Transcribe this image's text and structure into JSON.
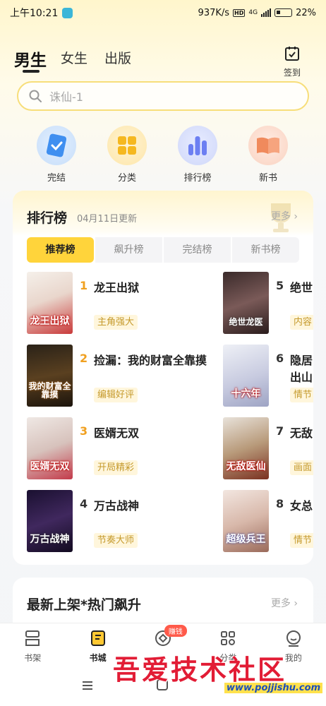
{
  "status_bar": {
    "time": "上午10:21",
    "net_speed": "937K/s",
    "hd": "HD",
    "network": "4G",
    "battery": "22%"
  },
  "top_nav": {
    "tabs": [
      {
        "label": "男生"
      },
      {
        "label": "女生"
      },
      {
        "label": "出版"
      }
    ],
    "active_tab": "男生",
    "checkin_label": "签到"
  },
  "search": {
    "placeholder": "诛仙-1"
  },
  "quick_entries": [
    {
      "label": "完结",
      "icon": "notebook-icon",
      "color": "#3f8ff0"
    },
    {
      "label": "分类",
      "icon": "category-grid-icon",
      "color": "#f5b820"
    },
    {
      "label": "排行榜",
      "icon": "bar-rank-icon",
      "color": "#6c7ff2"
    },
    {
      "label": "新书",
      "icon": "open-book-icon",
      "color": "#f08a5c"
    }
  ],
  "ranking": {
    "title": "排行榜",
    "updated": "04月11日更新",
    "more": "更多",
    "tabs": [
      {
        "label": "推荐榜"
      },
      {
        "label": "飙升榜"
      },
      {
        "label": "完结榜"
      },
      {
        "label": "新书榜"
      }
    ],
    "active_tab": "推荐榜",
    "books": [
      {
        "rank": "1",
        "title": "龙王出狱",
        "tag": "主角强大",
        "cover_text": "龙王出狱"
      },
      {
        "rank": "2",
        "title": "捡漏：我的财富全靠摸",
        "tag": "编辑好评",
        "cover_text": "我的财富全靠摸"
      },
      {
        "rank": "3",
        "title": "医婿无双",
        "tag": "开局精彩",
        "cover_text": "医婿无双"
      },
      {
        "rank": "4",
        "title": "万古战神",
        "tag": "节奏大师",
        "cover_text": "万古战神"
      },
      {
        "rank": "5",
        "title": "绝世",
        "tag": "内容",
        "cover_text": "绝世龙医"
      },
      {
        "rank": "6",
        "title": "隐居",
        "title_line2": "出山",
        "tag": "情节",
        "cover_text": "十六年"
      },
      {
        "rank": "7",
        "title": "无敌",
        "tag": "画面",
        "cover_text": "无敌医仙"
      },
      {
        "rank": "8",
        "title": "女总",
        "tag": "情节",
        "cover_text": "超级兵王"
      }
    ]
  },
  "new_section": {
    "title": "最新上架*热门飙升",
    "more": "更多"
  },
  "bottom_nav": {
    "items": [
      {
        "label": "书架",
        "icon": "shelf-icon"
      },
      {
        "label": "书城",
        "icon": "bookstore-icon"
      },
      {
        "label": "赚钱",
        "icon": "coin-icon",
        "badge": "赚钱"
      },
      {
        "label": "分类",
        "icon": "grid-icon"
      },
      {
        "label": "我的",
        "icon": "profile-icon"
      }
    ],
    "active": "书城"
  },
  "watermark": {
    "text": "吾爱技术社区",
    "url": "www.pojjishu.com"
  }
}
